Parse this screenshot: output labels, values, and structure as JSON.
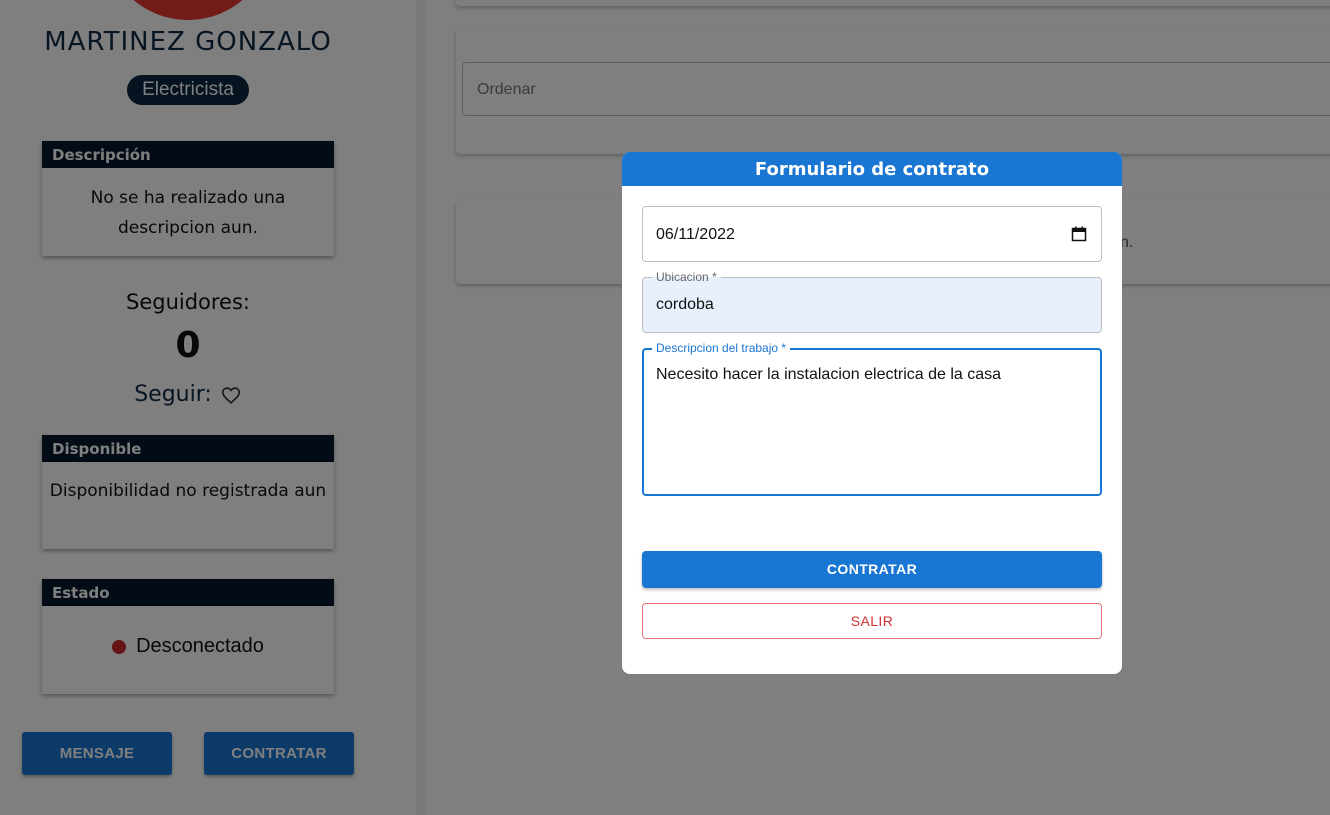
{
  "profile": {
    "name": "MARTINEZ GONZALO",
    "role": "Electricista",
    "description": {
      "title": "Descripción",
      "text": "No se ha realizado una descripcion aun."
    },
    "followers_label": "Seguidores:",
    "followers_count": "0",
    "follow_label": "Seguir:",
    "availability": {
      "title": "Disponible",
      "text": "Disponibilidad no registrada aun"
    },
    "status": {
      "title": "Estado",
      "text": "Desconectado",
      "color": "#c62828"
    },
    "buttons": {
      "message": "MENSAJE",
      "hire": "CONTRATAR"
    }
  },
  "main": {
    "order_placeholder": "Ordenar",
    "result_tail": "n."
  },
  "modal": {
    "title": "Formulario de contrato",
    "date_value": "06/11/2022",
    "location_label": "Ubicacion *",
    "location_value": "cordoba",
    "description_label": "Descripcion del trabajo *",
    "description_value": "Necesito hacer la instalacion electrica de la casa",
    "submit_label": "CONTRATAR",
    "exit_label": "SALIR"
  },
  "colors": {
    "primary": "#1976d2",
    "dark_header": "#06192c",
    "danger": "#d32f2f",
    "avatar": "#e53935"
  },
  "icons": {
    "follow": "heart-outline-icon",
    "date": "calendar-icon",
    "status": "status-dot-icon"
  }
}
